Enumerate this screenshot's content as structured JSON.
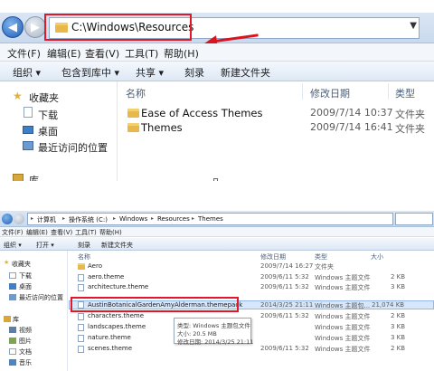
{
  "top": {
    "address": "C:\\Windows\\Resources",
    "menu": [
      "文件(F)",
      "编辑(E)",
      "查看(V)",
      "工具(T)",
      "帮助(H)"
    ],
    "toolbar": [
      "组织 ▾",
      "包含到库中 ▾",
      "共享 ▾",
      "刻录",
      "新建文件夹"
    ],
    "nav": {
      "favorites": "收藏夹",
      "download": "下载",
      "desktop": "桌面",
      "recent": "最近访问的位置",
      "library": "库"
    },
    "columns": {
      "name": "名称",
      "date": "修改日期",
      "type": "类型"
    },
    "rows": [
      {
        "name": "Ease of Access Themes",
        "date": "2009/7/14 10:37",
        "type": "文件夹"
      },
      {
        "name": "Themes",
        "date": "2009/7/14 16:41",
        "type": "文件夹"
      }
    ]
  },
  "bottom": {
    "breadcrumbs": [
      "计算机",
      "操作系统 (C:)",
      "Windows",
      "Resources",
      "Themes"
    ],
    "menu": [
      "文件(F)",
      "编辑(E)",
      "查看(V)",
      "工具(T)",
      "帮助(H)"
    ],
    "toolbar": [
      "组织 ▾",
      "打开 ▾",
      "刻录",
      "新建文件夹"
    ],
    "nav": {
      "favorites": "收藏夹",
      "download": "下载",
      "desktop": "桌面",
      "recent": "最近访问的位置",
      "library": "库",
      "video": "视频",
      "pictures": "图片",
      "documents": "文档",
      "music": "音乐"
    },
    "columns": {
      "name": "名称",
      "date": "修改日期",
      "type": "类型",
      "size": "大小"
    },
    "rows": [
      {
        "name": "Aero",
        "date": "2009/7/14 16:27",
        "type": "文件夹",
        "size": "",
        "kind": "folder"
      },
      {
        "name": "aero.theme",
        "date": "2009/6/11 5:32",
        "type": "Windows 主题文件",
        "size": "2 KB",
        "kind": "file"
      },
      {
        "name": "architecture.theme",
        "date": "2009/6/11 5:32",
        "type": "Windows 主题文件",
        "size": "3 KB",
        "kind": "file"
      },
      {
        "name": "AustinBotanicalGardenAmyAlderman.themepack",
        "date": "2014/3/25 21:11",
        "type": "Windows 主题包...",
        "size": "21,074 KB",
        "kind": "file",
        "selected": true
      },
      {
        "name": "characters.theme",
        "date": "2009/6/11 5:32",
        "type": "Windows 主题文件",
        "size": "2 KB",
        "kind": "file"
      },
      {
        "name": "landscapes.theme",
        "date": "2009/6/11 5:32",
        "type": "Windows 主题文件",
        "size": "3 KB",
        "kind": "file"
      },
      {
        "name": "nature.theme",
        "date": "2009/6/11 5:32",
        "type": "Windows 主题文件",
        "size": "3 KB",
        "kind": "file"
      },
      {
        "name": "scenes.theme",
        "date": "2009/6/11 5:32",
        "type": "Windows 主题文件",
        "size": "2 KB",
        "kind": "file"
      }
    ],
    "tooltip": {
      "type": "类型: Windows 主题包文件",
      "size": "大小: 20.5 MB",
      "date": "修改日期: 2014/3/25 21:11"
    }
  },
  "colors": {
    "highlight": "#e0182a",
    "selection": "#d6e6fb",
    "folder": "#e8b84a"
  }
}
